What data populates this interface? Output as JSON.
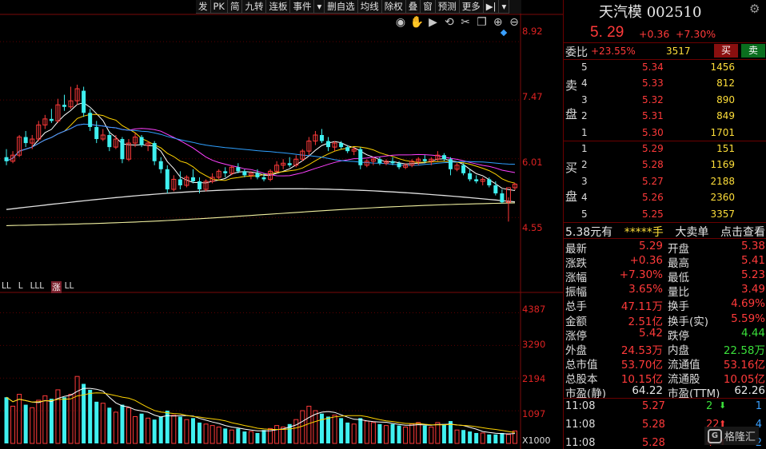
{
  "toolbar": {
    "buttons": [
      "发",
      "PK",
      "简",
      "九转",
      "连板",
      "事件",
      "▾",
      "删自选",
      "均线",
      "除权",
      "叠",
      "窗",
      "预测",
      "更多",
      "▶|",
      "▾"
    ]
  },
  "chart_toolbar": {
    "icons": [
      "eye-icon",
      "hand-icon",
      "play-icon",
      "rewind-icon",
      "scissors-icon",
      "copy-icon",
      "zoom-in-icon",
      "zoom-out-icon"
    ],
    "glyphs": [
      "◉",
      "✋",
      "▶",
      "⟲",
      "✂",
      "❐",
      "⊕",
      "⊖"
    ]
  },
  "price_axis": {
    "ticks": [
      "8.92",
      "7.47",
      "6.01",
      "4.55"
    ]
  },
  "volume_axis": {
    "ticks": [
      "4387",
      "3290",
      "2194",
      "1097"
    ],
    "unit_label": "X1000"
  },
  "signal_row": [
    "LL",
    "L",
    "LLL",
    "涨",
    "LL"
  ],
  "quote": {
    "name_code": "天汽模 002510",
    "price": "5. 29",
    "change": "+0.36",
    "change_pct": "+7.30%",
    "weibi_label": "委比",
    "weibi_pct": "+23.55%",
    "weicha": "3517",
    "buy_btn": "买",
    "sell_btn": "卖"
  },
  "order_book": {
    "sell_label": [
      "卖",
      "盘"
    ],
    "buy_label": [
      "买",
      "盘"
    ],
    "sell": [
      {
        "level": "5",
        "price": "5.34",
        "qty": "1456"
      },
      {
        "level": "4",
        "price": "5.33",
        "qty": "812"
      },
      {
        "level": "3",
        "price": "5.32",
        "qty": "890"
      },
      {
        "level": "2",
        "price": "5.31",
        "qty": "849"
      },
      {
        "level": "1",
        "price": "5.30",
        "qty": "1701"
      }
    ],
    "buy": [
      {
        "level": "1",
        "price": "5.29",
        "qty": "151"
      },
      {
        "level": "2",
        "price": "5.28",
        "qty": "1169"
      },
      {
        "level": "3",
        "price": "5.27",
        "qty": "2188"
      },
      {
        "level": "4",
        "price": "5.26",
        "qty": "2360"
      },
      {
        "level": "5",
        "price": "5.25",
        "qty": "3357"
      }
    ]
  },
  "mid_row": {
    "price": "5.38元有",
    "qty": "*****手",
    "big": "大卖单",
    "link": "点击查看"
  },
  "stats": [
    {
      "k1": "最新",
      "v1": "5.29",
      "c1": "red",
      "k2": "开盘",
      "v2": "5.38",
      "c2": "red"
    },
    {
      "k1": "涨跌",
      "v1": "+0.36",
      "c1": "red",
      "k2": "最高",
      "v2": "5.41",
      "c2": "red"
    },
    {
      "k1": "涨幅",
      "v1": "+7.30%",
      "c1": "red",
      "k2": "最低",
      "v2": "5.23",
      "c2": "red"
    },
    {
      "k1": "振幅",
      "v1": "3.65%",
      "c1": "red",
      "k2": "量比",
      "v2": "3.49",
      "c2": "red"
    },
    {
      "k1": "总手",
      "v1": "47.11万",
      "c1": "red",
      "k2": "换手",
      "v2": "4.69%",
      "c2": "red"
    },
    {
      "k1": "金额",
      "v1": "2.51亿",
      "c1": "red",
      "k2": "换手(实)",
      "v2": "5.59%",
      "c2": "red"
    },
    {
      "k1": "涨停",
      "v1": "5.42",
      "c1": "red",
      "k2": "跌停",
      "v2": "4.44",
      "c2": "grn"
    },
    {
      "k1": "外盘",
      "v1": "24.53万",
      "c1": "red",
      "k2": "内盘",
      "v2": "22.58万",
      "c2": "grn"
    },
    {
      "k1": "总市值",
      "v1": "53.70亿",
      "c1": "red",
      "k2": "流通值",
      "v2": "53.16亿",
      "c2": "red"
    },
    {
      "k1": "总股本",
      "v1": "10.15亿",
      "c1": "red",
      "k2": "流通股",
      "v2": "10.05亿",
      "c2": "red"
    },
    {
      "k1": "市盈(静)",
      "v1": "64.22",
      "c1": "wht",
      "k2": "市盈(TTM)",
      "v2": "62.26",
      "c2": "wht"
    }
  ],
  "ticks": [
    {
      "time": "11:08",
      "price": "5.27",
      "vol": "2",
      "arrow": "down",
      "count": "1"
    },
    {
      "time": "11:08",
      "price": "5.28",
      "vol": "22",
      "arrow": "up",
      "count": "4"
    },
    {
      "time": "11:08",
      "price": "5.28",
      "vol": "4",
      "arrow": "up",
      "count": "2"
    }
  ],
  "watermark": {
    "logo": "G",
    "text": "格隆汇"
  },
  "colors": {
    "up": "#ff3a3a",
    "down": "#3ff0f0",
    "accent_border": "#6a0000"
  },
  "chart_data": {
    "type": "candlestick",
    "ylim": [
      4.0,
      9.2
    ],
    "ohlc": [
      [
        6.05,
        6.25,
        5.85,
        5.95
      ],
      [
        5.95,
        6.2,
        5.9,
        6.1
      ],
      [
        6.1,
        6.6,
        6.05,
        6.55
      ],
      [
        6.55,
        6.7,
        6.3,
        6.4
      ],
      [
        6.4,
        6.6,
        6.25,
        6.5
      ],
      [
        6.5,
        6.95,
        6.45,
        6.85
      ],
      [
        6.85,
        7.1,
        6.75,
        7.0
      ],
      [
        7.0,
        7.25,
        6.9,
        6.95
      ],
      [
        6.95,
        7.5,
        6.9,
        7.35
      ],
      [
        7.35,
        7.6,
        7.2,
        7.3
      ],
      [
        7.3,
        7.8,
        7.25,
        7.45
      ],
      [
        7.45,
        7.85,
        7.35,
        7.75
      ],
      [
        7.7,
        7.8,
        7.05,
        7.15
      ],
      [
        7.15,
        7.25,
        6.7,
        6.8
      ],
      [
        6.8,
        6.95,
        6.4,
        6.5
      ],
      [
        6.5,
        6.75,
        6.45,
        6.6
      ],
      [
        6.6,
        6.7,
        6.2,
        6.3
      ],
      [
        6.3,
        6.6,
        6.25,
        6.5
      ],
      [
        6.5,
        6.55,
        5.9,
        6.0
      ],
      [
        6.0,
        6.5,
        5.95,
        6.4
      ],
      [
        6.4,
        6.65,
        6.3,
        6.55
      ],
      [
        6.55,
        6.6,
        6.3,
        6.35
      ],
      [
        6.35,
        6.45,
        6.2,
        6.4
      ],
      [
        6.4,
        6.45,
        5.85,
        5.95
      ],
      [
        5.95,
        6.05,
        5.65,
        5.75
      ],
      [
        5.75,
        5.85,
        5.15,
        5.25
      ],
      [
        5.25,
        5.6,
        5.2,
        5.5
      ],
      [
        5.5,
        5.7,
        5.25,
        5.35
      ],
      [
        5.35,
        5.6,
        5.3,
        5.55
      ],
      [
        5.55,
        5.75,
        5.4,
        5.45
      ],
      [
        5.45,
        5.55,
        5.15,
        5.25
      ],
      [
        5.25,
        5.5,
        5.2,
        5.45
      ],
      [
        5.45,
        5.65,
        5.4,
        5.55
      ],
      [
        5.55,
        5.75,
        5.5,
        5.7
      ],
      [
        5.7,
        5.8,
        5.55,
        5.65
      ],
      [
        5.65,
        5.85,
        5.6,
        5.8
      ],
      [
        5.8,
        5.9,
        5.65,
        5.7
      ],
      [
        5.7,
        5.75,
        5.55,
        5.6
      ],
      [
        5.6,
        5.7,
        5.5,
        5.65
      ],
      [
        5.65,
        5.75,
        5.5,
        5.55
      ],
      [
        5.55,
        5.65,
        5.45,
        5.5
      ],
      [
        5.5,
        5.75,
        5.45,
        5.7
      ],
      [
        5.7,
        5.95,
        5.65,
        5.85
      ],
      [
        5.85,
        6.0,
        5.75,
        5.9
      ],
      [
        5.9,
        6.05,
        5.8,
        5.85
      ],
      [
        5.85,
        6.1,
        5.8,
        6.0
      ],
      [
        6.0,
        6.25,
        5.95,
        6.2
      ],
      [
        6.2,
        6.55,
        6.1,
        6.45
      ],
      [
        6.45,
        6.7,
        6.35,
        6.6
      ],
      [
        6.6,
        6.75,
        6.4,
        6.45
      ],
      [
        6.45,
        6.55,
        6.2,
        6.3
      ],
      [
        6.3,
        6.45,
        6.2,
        6.4
      ],
      [
        6.4,
        6.45,
        6.25,
        6.3
      ],
      [
        6.3,
        6.35,
        6.15,
        6.2
      ],
      [
        6.2,
        6.3,
        6.1,
        6.25
      ],
      [
        6.25,
        6.3,
        5.75,
        5.85
      ],
      [
        5.85,
        6.0,
        5.8,
        5.95
      ],
      [
        5.95,
        6.05,
        5.85,
        6.0
      ],
      [
        6.0,
        6.05,
        5.85,
        5.9
      ],
      [
        5.9,
        6.0,
        5.85,
        5.95
      ],
      [
        5.95,
        6.05,
        5.85,
        5.9
      ],
      [
        5.9,
        5.95,
        5.75,
        5.8
      ],
      [
        5.8,
        5.9,
        5.75,
        5.85
      ],
      [
        5.85,
        6.0,
        5.8,
        5.95
      ],
      [
        5.95,
        6.05,
        5.85,
        6.0
      ],
      [
        6.0,
        6.1,
        5.9,
        5.95
      ],
      [
        5.95,
        6.05,
        5.85,
        6.0
      ],
      [
        6.0,
        6.2,
        5.95,
        6.1
      ],
      [
        6.1,
        6.15,
        5.95,
        6.0
      ],
      [
        6.0,
        6.05,
        5.6,
        5.75
      ],
      [
        5.75,
        5.9,
        5.7,
        5.85
      ],
      [
        5.85,
        5.9,
        5.6,
        5.65
      ],
      [
        5.65,
        5.75,
        5.45,
        5.5
      ],
      [
        5.5,
        5.6,
        5.4,
        5.45
      ],
      [
        5.45,
        5.55,
        5.35,
        5.5
      ],
      [
        5.5,
        5.55,
        5.3,
        5.35
      ],
      [
        5.35,
        5.45,
        5.1,
        5.15
      ],
      [
        5.15,
        5.25,
        4.9,
        4.93
      ],
      [
        4.93,
        5.05,
        4.45,
        5.29
      ],
      [
        5.29,
        5.41,
        5.23,
        5.38
      ]
    ],
    "volume": [
      1550,
      1250,
      1650,
      1300,
      1200,
      1450,
      1600,
      1500,
      1800,
      1550,
      1650,
      2250,
      2000,
      1800,
      1400,
      1350,
      1200,
      1050,
      1300,
      1200,
      900,
      1000,
      850,
      800,
      900,
      1100,
      950,
      900,
      800,
      850,
      700,
      650,
      600,
      550,
      500,
      450,
      500,
      400,
      400,
      350,
      450,
      500,
      600,
      550,
      650,
      800,
      1100,
      1250,
      1100,
      1000,
      900,
      950,
      850,
      700,
      650,
      850,
      750,
      700,
      650,
      600,
      650,
      600,
      550,
      650,
      700,
      600,
      550,
      700,
      650,
      750,
      450,
      450,
      400,
      350,
      350,
      300,
      300,
      350,
      300,
      420
    ]
  }
}
